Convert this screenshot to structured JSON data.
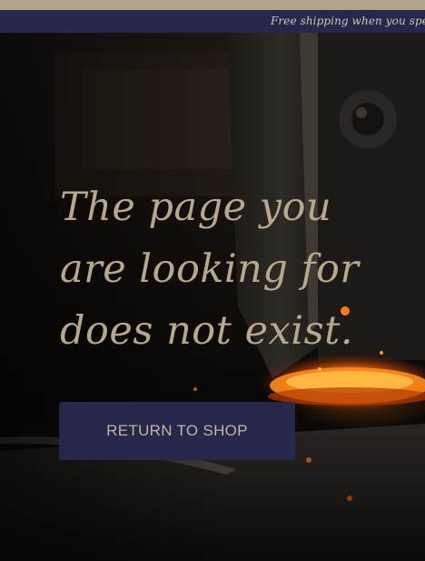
{
  "announcement": {
    "text": "Free shipping when you spend o"
  },
  "hero": {
    "headline": "The page you are looking for does not exist.",
    "background_image": "forge-hammer-glowing-coin-photo",
    "return_button_label": "RETURN TO SHOP"
  },
  "colors": {
    "accent_navy": "#26274a",
    "text_tan": "#b7a78e",
    "top_strip": "#b4a48c"
  }
}
